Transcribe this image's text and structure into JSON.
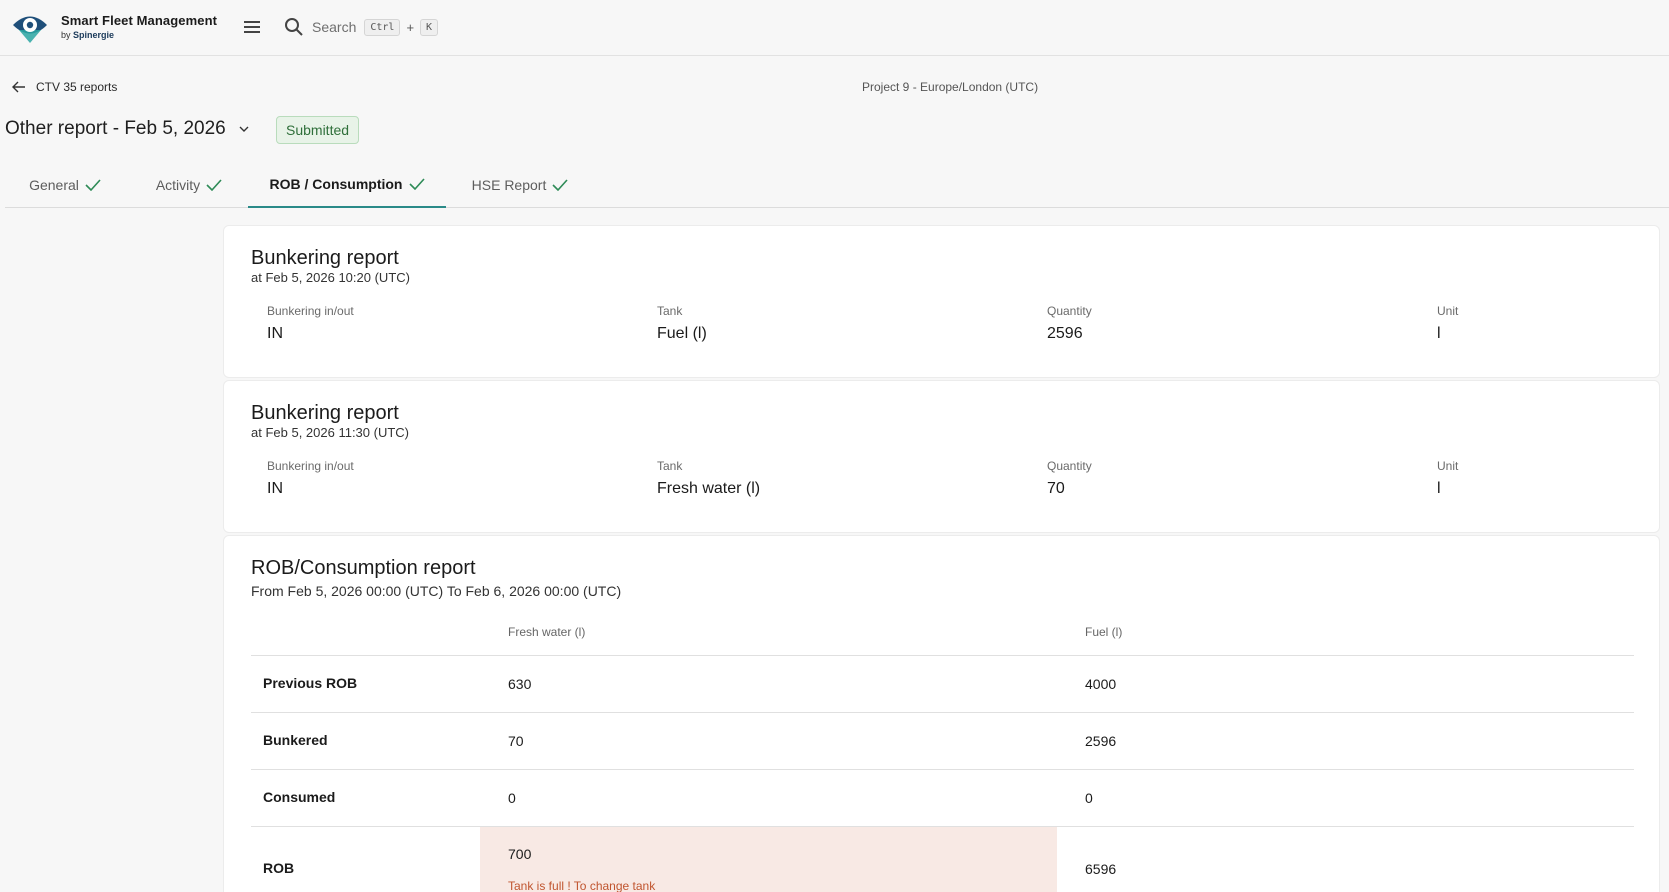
{
  "app": {
    "title": "Smart Fleet Management",
    "byline_prefix": "by",
    "byline_brand": "Spinergie",
    "brand_color": "#2a8a88"
  },
  "search": {
    "label": "Search",
    "shortcut_key1": "Ctrl",
    "shortcut_plus": "+",
    "shortcut_key2": "K"
  },
  "nav": {
    "back_label": "CTV 35 reports",
    "project_label": "Project 9 - Europe/London (UTC)"
  },
  "report": {
    "title": "Other report - Feb 5, 2026",
    "status": "Submitted"
  },
  "tabs": [
    {
      "label": "General",
      "complete": true
    },
    {
      "label": "Activity",
      "complete": true
    },
    {
      "label": "ROB / Consumption",
      "complete": true,
      "active": true
    },
    {
      "label": "HSE Report",
      "complete": true
    }
  ],
  "bunkering": [
    {
      "title": "Bunkering report",
      "subtitle": "at Feb 5, 2026 10:20 (UTC)",
      "fields": [
        {
          "label": "Bunkering in/out",
          "value": "IN"
        },
        {
          "label": "Tank",
          "value": "Fuel (l)"
        },
        {
          "label": "Quantity",
          "value": "2596"
        },
        {
          "label": "Unit",
          "value": "l"
        }
      ]
    },
    {
      "title": "Bunkering report",
      "subtitle": "at Feb 5, 2026 11:30 (UTC)",
      "fields": [
        {
          "label": "Bunkering in/out",
          "value": "IN"
        },
        {
          "label": "Tank",
          "value": "Fresh water (l)"
        },
        {
          "label": "Quantity",
          "value": "70"
        },
        {
          "label": "Unit",
          "value": "l"
        }
      ]
    }
  ],
  "rob": {
    "title": "ROB/Consumption report",
    "subtitle": "From Feb 5, 2026 00:00 (UTC) To Feb 6, 2026 00:00 (UTC)",
    "columns": [
      "Fresh water (l)",
      "Fuel (l)"
    ],
    "rows": [
      {
        "label": "Previous ROB",
        "values": [
          "630",
          "4000"
        ]
      },
      {
        "label": "Bunkered",
        "values": [
          "70",
          "2596"
        ]
      },
      {
        "label": "Consumed",
        "values": [
          "0",
          "0"
        ]
      },
      {
        "label": "ROB",
        "values": [
          "700",
          "6596"
        ]
      }
    ],
    "warning": "Tank is full ! To change tank",
    "warning_color": "#c0552f"
  }
}
